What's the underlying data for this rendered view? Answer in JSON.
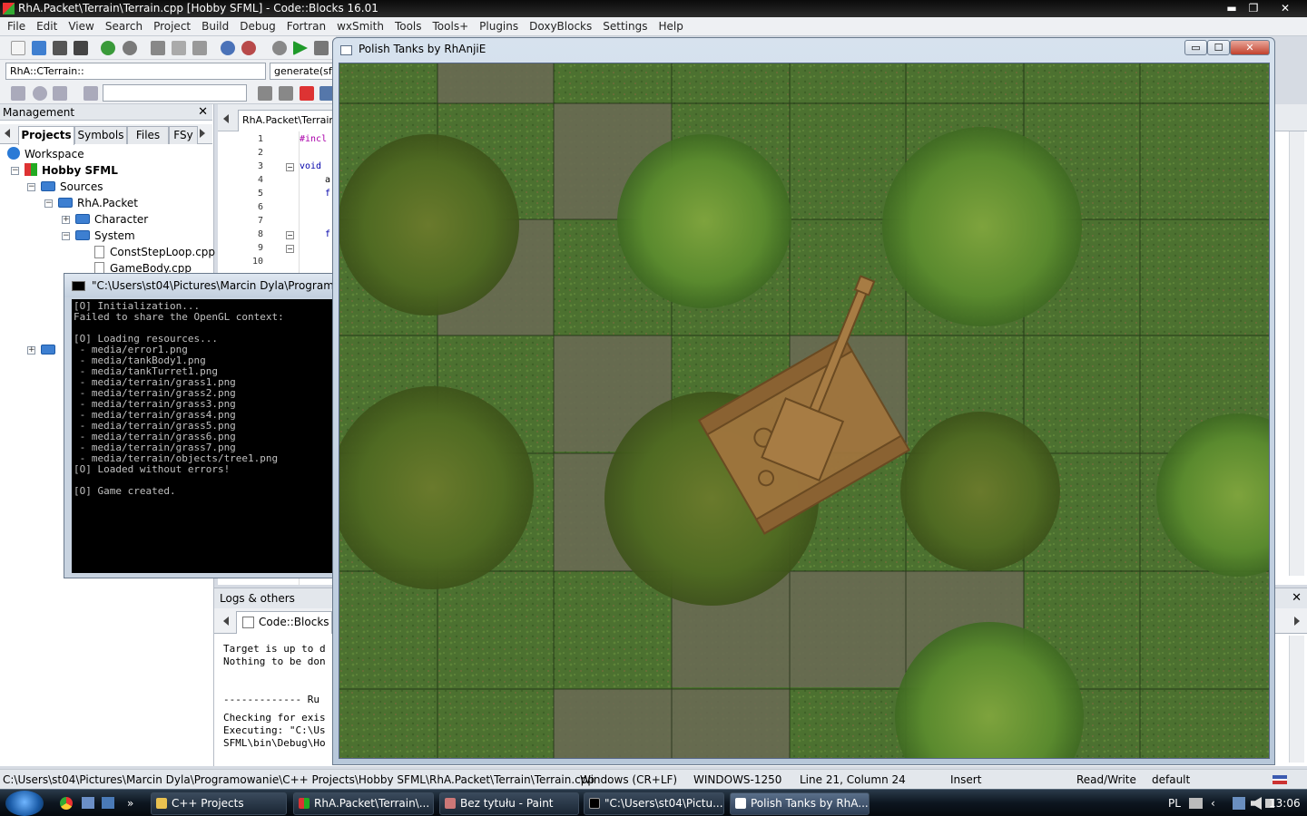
{
  "window": {
    "title": "RhA.Packet\\Terrain\\Terrain.cpp [Hobby SFML] - Code::Blocks 16.01",
    "min_glyph": "▬",
    "max_glyph": "❐",
    "close_glyph": "✕"
  },
  "menu": [
    "File",
    "Edit",
    "View",
    "Search",
    "Project",
    "Build",
    "Debug",
    "Fortran",
    "wxSmith",
    "Tools",
    "Tools+",
    "Plugins",
    "DoxyBlocks",
    "Settings",
    "Help"
  ],
  "toolbar": {
    "scope_combo": "RhA::CTerrain::",
    "function_combo": "generate(sf::",
    "search_combo": ""
  },
  "management": {
    "title": "Management",
    "close_glyph": "✕",
    "tabs": [
      "Projects",
      "Symbols",
      "Files",
      "FSy"
    ],
    "tree": [
      {
        "label": "Workspace",
        "kind": "workspace",
        "depth": 0
      },
      {
        "label": "Hobby SFML",
        "kind": "project",
        "depth": 1
      },
      {
        "label": "Sources",
        "kind": "folder",
        "depth": 2
      },
      {
        "label": "RhA.Packet",
        "kind": "folder",
        "depth": 3
      },
      {
        "label": "Character",
        "kind": "folder",
        "depth": 4
      },
      {
        "label": "System",
        "kind": "folder",
        "depth": 4
      },
      {
        "label": "ConstStepLoop.cpp",
        "kind": "file",
        "depth": 5
      },
      {
        "label": "GameBody.cpp",
        "kind": "file",
        "depth": 5
      }
    ]
  },
  "editor": {
    "tab_label": "RhA.Packet\\Terrain\\",
    "line_numbers": [
      "1",
      "2",
      "3",
      "4",
      "5",
      "6",
      "7",
      "8",
      "9",
      "10"
    ],
    "code_fragments": [
      "#incl",
      "void",
      "a",
      "f",
      "f"
    ]
  },
  "logs": {
    "title": "Logs & others",
    "close_glyph": "✕",
    "tab_label": "Code::Blocks",
    "lines": [
      "Target is up to d",
      "Nothing to be don",
      "",
      "",
      "------------- Ru",
      "",
      "Checking for exis",
      "Executing: \"C:\\Us",
      "SFML\\bin\\Debug\\Ho"
    ]
  },
  "console": {
    "title": "\"C:\\Users\\st04\\Pictures\\Marcin Dyla\\Programowa",
    "lines": [
      "[O] Initialization...",
      "Failed to share the OpenGL context:",
      "",
      "[O] Loading resources...",
      " - media/error1.png",
      " - media/tankBody1.png",
      " - media/tankTurret1.png",
      " - media/terrain/grass1.png",
      " - media/terrain/grass2.png",
      " - media/terrain/grass3.png",
      " - media/terrain/grass4.png",
      " - media/terrain/grass5.png",
      " - media/terrain/grass6.png",
      " - media/terrain/grass7.png",
      " - media/terrain/objects/tree1.png",
      "[O] Loaded without errors!",
      "",
      "[O] Game created."
    ]
  },
  "game": {
    "title": "Polish Tanks by RhAnjiE",
    "min_glyph": "▭",
    "max_glyph": "☐",
    "close_glyph": "✕"
  },
  "status": {
    "path": "C:\\Users\\st04\\Pictures\\Marcin Dyla\\Programowanie\\C++ Projects\\Hobby SFML\\RhA.Packet\\Terrain\\Terrain.cpp",
    "eol": "Windows (CR+LF)",
    "encoding": "WINDOWS-1250",
    "position": "Line 21, Column 24",
    "mode": "Insert",
    "access": "Read/Write",
    "profile": "default"
  },
  "taskbar": {
    "items": [
      "C++ Projects",
      "RhA.Packet\\Terrain\\...",
      "Bez tytułu - Paint",
      "\"C:\\Users\\st04\\Pictu...",
      "Polish Tanks by RhA..."
    ],
    "language": "PL",
    "clock": "13:06",
    "more_glyph": "»"
  },
  "colors": {
    "grass": "#4c7130",
    "tank": "#a0753e",
    "tree_dark": "#4f6a22",
    "tree_light": "#6b8f33",
    "stone": "#6b6a55"
  }
}
